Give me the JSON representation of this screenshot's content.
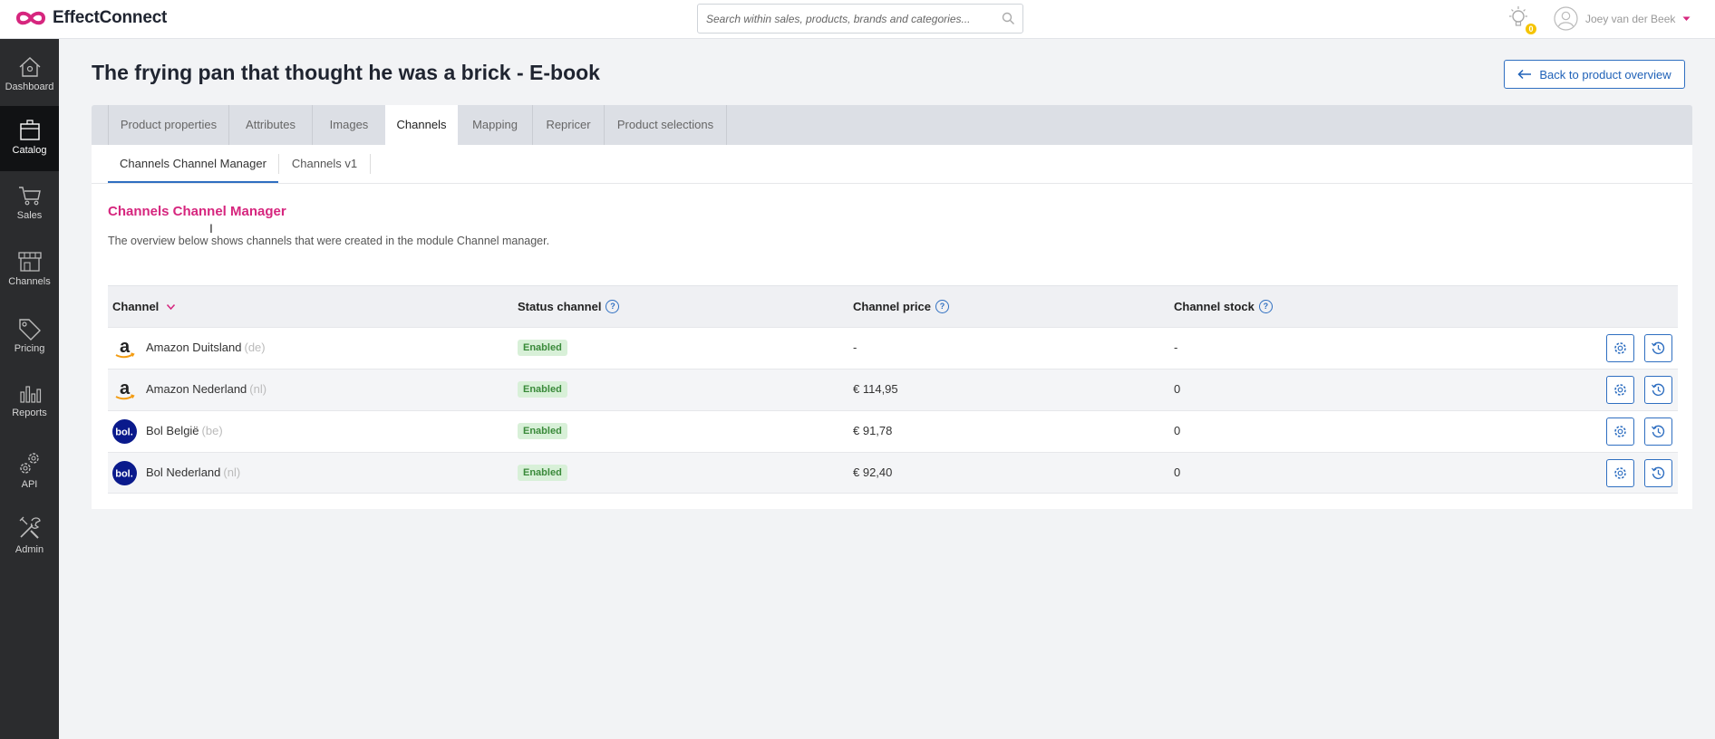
{
  "app": {
    "brand": "EffectConnect"
  },
  "search": {
    "placeholder": "Search within sales, products, brands and categories..."
  },
  "notifications": {
    "count": "0"
  },
  "user": {
    "name": "Joey van der Beek"
  },
  "sidebar": {
    "items": [
      {
        "label": "Dashboard",
        "icon": "home-icon"
      },
      {
        "label": "Catalog",
        "icon": "box-icon",
        "active": true
      },
      {
        "label": "Sales",
        "icon": "cart-icon"
      },
      {
        "label": "Channels",
        "icon": "store-icon"
      },
      {
        "label": "Pricing",
        "icon": "tag-icon"
      },
      {
        "label": "Reports",
        "icon": "bar-chart-icon"
      },
      {
        "label": "API",
        "icon": "gears-icon"
      },
      {
        "label": "Admin",
        "icon": "tools-icon"
      }
    ]
  },
  "page": {
    "title": "The frying pan that thought he was a brick - E-book",
    "back_label": "Back to product overview"
  },
  "tabs": [
    {
      "label": "Product properties"
    },
    {
      "label": "Attributes"
    },
    {
      "label": "Images"
    },
    {
      "label": "Channels",
      "active": true
    },
    {
      "label": "Mapping"
    },
    {
      "label": "Repricer"
    },
    {
      "label": "Product selections"
    }
  ],
  "subtabs": [
    {
      "label": "Channels Channel Manager",
      "active": true
    },
    {
      "label": "Channels v1"
    }
  ],
  "section": {
    "title": "Channels Channel Manager",
    "description": "The overview below shows channels that were created in the module Channel manager."
  },
  "table": {
    "headers": {
      "channel": "Channel",
      "status": "Status channel",
      "price": "Channel price",
      "stock": "Channel stock"
    },
    "rows": [
      {
        "logo": "amazon",
        "name": "Amazon Duitsland",
        "code": "(de)",
        "status": "Enabled",
        "price": "-",
        "stock": "-"
      },
      {
        "logo": "amazon",
        "name": "Amazon Nederland",
        "code": "(nl)",
        "status": "Enabled",
        "price": "€ 114,95",
        "stock": "0"
      },
      {
        "logo": "bol",
        "name": "Bol België",
        "code": "(be)",
        "status": "Enabled",
        "price": "€ 91,78",
        "stock": "0"
      },
      {
        "logo": "bol",
        "name": "Bol Nederland",
        "code": "(nl)",
        "status": "Enabled",
        "price": "€ 92,40",
        "stock": "0"
      }
    ]
  },
  "colors": {
    "accent": "#2f6fc1",
    "section_title": "#d6267e",
    "sidebar": "#2b2c2e",
    "enabled_badge": "#d8f0d8"
  }
}
